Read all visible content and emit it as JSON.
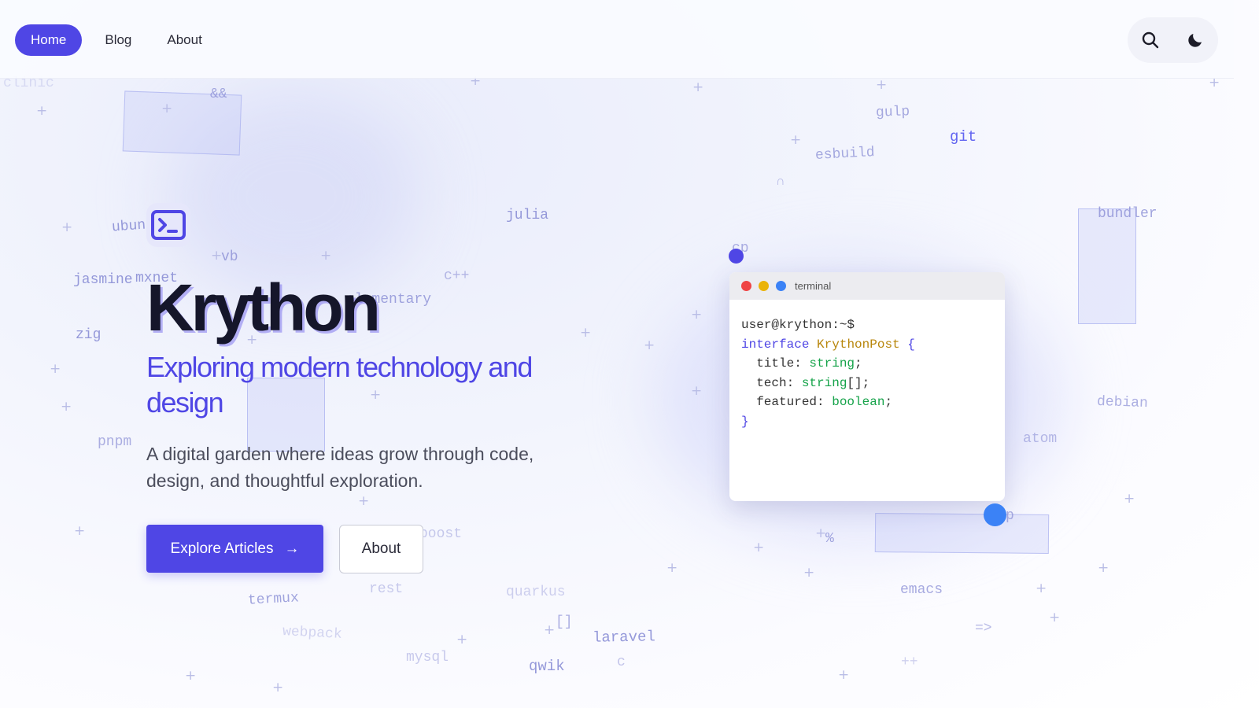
{
  "nav": {
    "items": [
      {
        "label": "Home",
        "active": true
      },
      {
        "label": "Blog",
        "active": false
      },
      {
        "label": "About",
        "active": false
      }
    ],
    "search_icon": "search-icon",
    "theme_icon": "moon-icon"
  },
  "hero": {
    "icon": "terminal-icon",
    "title": "Krython",
    "subtitle": "Exploring modern technology and design",
    "description": "A digital garden where ideas grow through code, design, and thoughtful exploration.",
    "primary_button": "Explore Articles",
    "primary_button_icon": "arrow-right-icon",
    "secondary_button": "About"
  },
  "terminal": {
    "title": "terminal",
    "prompt": "user@krython:~$",
    "code": {
      "kw_interface": "interface",
      "type_name": "KrythonPost",
      "open_brace": "{",
      "field1": "title",
      "type1": "string",
      "field2": "tech",
      "type2": "string",
      "suffix2": "[];",
      "field3": "featured",
      "type3": "boolean",
      "close_brace": "}"
    },
    "dot_colors": [
      "#ef4444",
      "#eab308",
      "#3b82f6"
    ]
  },
  "background_words": {
    "w1": "&&",
    "w2": "gulp",
    "w3": "git",
    "w4": "esbuild",
    "w5": "∩",
    "w6": "julia",
    "w7": "ubun",
    "w8": "vb",
    "w9": "jasmine",
    "w10": "mxnet",
    "w11": "c++",
    "w12": "zig",
    "w13": "bundler",
    "w14": "cp",
    "w15": "pnpm",
    "w16": "debian",
    "w17": "atom",
    "w18": "boost",
    "w19": "termux",
    "w20": "rest",
    "w21": "quarkus",
    "w22": "emacs",
    "w23": "webpack",
    "w24": "[]",
    "w25": "laravel",
    "w26": "mysql",
    "w27": "qwik",
    "w28": "c",
    "w29": "=>",
    "w30": "++",
    "w31": "%",
    "w32": "p",
    "w33": "clinic",
    "w34": "elementary"
  },
  "colors": {
    "accent": "#4f46e5",
    "title": "#15162a",
    "dot_purple": "#4f46e5",
    "dot_blue": "#3b82f6"
  }
}
